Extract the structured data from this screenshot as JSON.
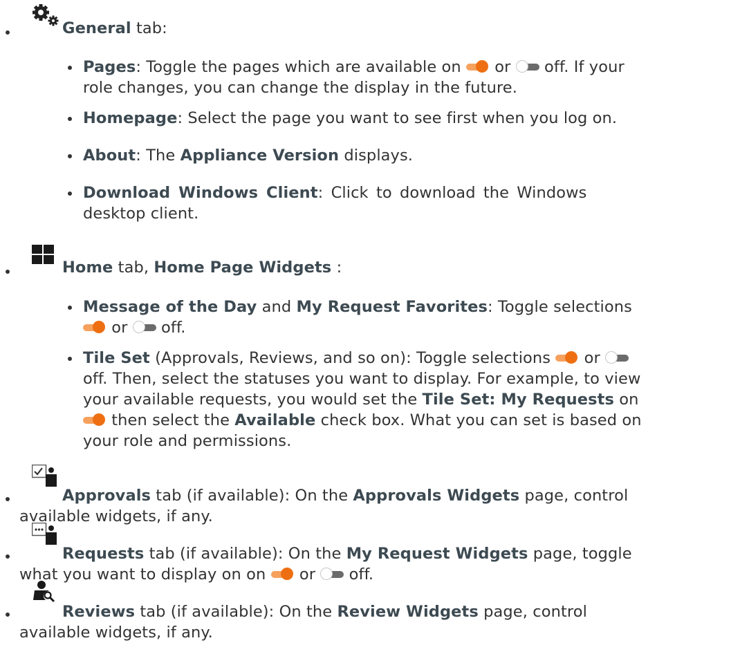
{
  "general": {
    "tab_name": "General",
    "tab_suffix": " tab:",
    "icon": "gears-icon",
    "pages": {
      "term": "Pages",
      "line1_a": ": Toggle the pages which are available on ",
      "line1_b": " or ",
      "line1_c": " off. If your",
      "line2": "role changes, you can change the display in the future."
    },
    "homepage": {
      "term": "Homepage",
      "text": ": Select the page you want to see first when you log on."
    },
    "about": {
      "term": "About",
      "text_a": ": The ",
      "term2": "Appliance Version",
      "text_b": " displays."
    },
    "download": {
      "term": "Download Windows Client",
      "line1": ": Click to download the Windows",
      "line2": "desktop client."
    }
  },
  "home": {
    "tab_name": "Home",
    "mid": " tab, ",
    "widgets_name": "Home Page Widgets",
    "suffix": " :",
    "icon": "tiles-icon",
    "message": {
      "term1": "Message of the Day",
      "and": " and ",
      "term2": "My Request Favorites",
      "line1_end": ": Toggle selections",
      "line2_a": " or ",
      "line2_b": " off."
    },
    "tileset": {
      "term": "Tile Set",
      "line1_a": " (Approvals, Reviews, and so on): Toggle selections ",
      "line1_b": " or ",
      "line2": "off. Then, select the statuses you want to display. For example, to view",
      "line3_a": "your available requests, you would set the ",
      "line3_term": "Tile Set: My Requests",
      "line3_b": " on",
      "line4_a": " then select the ",
      "line4_term": "Available",
      "line4_b": " check box. What you can set is based on",
      "line5": "your role and permissions."
    }
  },
  "approvals": {
    "icon": "approvals-icon",
    "tab_name": "Approvals",
    "text_a": " tab (if available): On the ",
    "widgets_name": "Approvals Widgets",
    "text_b": " page, control",
    "line2": "available widgets, if any."
  },
  "requests": {
    "icon": "requests-icon",
    "tab_name": "Requests",
    "text_a": " tab (if available): On the ",
    "widgets_name": "My Request Widgets",
    "text_b": " page, toggle",
    "line2_a": "what you want to display on on ",
    "line2_b": " or ",
    "line2_c": " off."
  },
  "reviews": {
    "icon": "reviews-icon",
    "tab_name": "Reviews",
    "text_a": " tab (if available): On the ",
    "widgets_name": "Review Widgets",
    "text_b": " page, control",
    "line2": "available widgets, if any."
  },
  "colors": {
    "text": "#333333",
    "heading": "#3d4a52",
    "toggle_on": "#ee6f12",
    "toggle_off_track": "#6b6b6b"
  }
}
